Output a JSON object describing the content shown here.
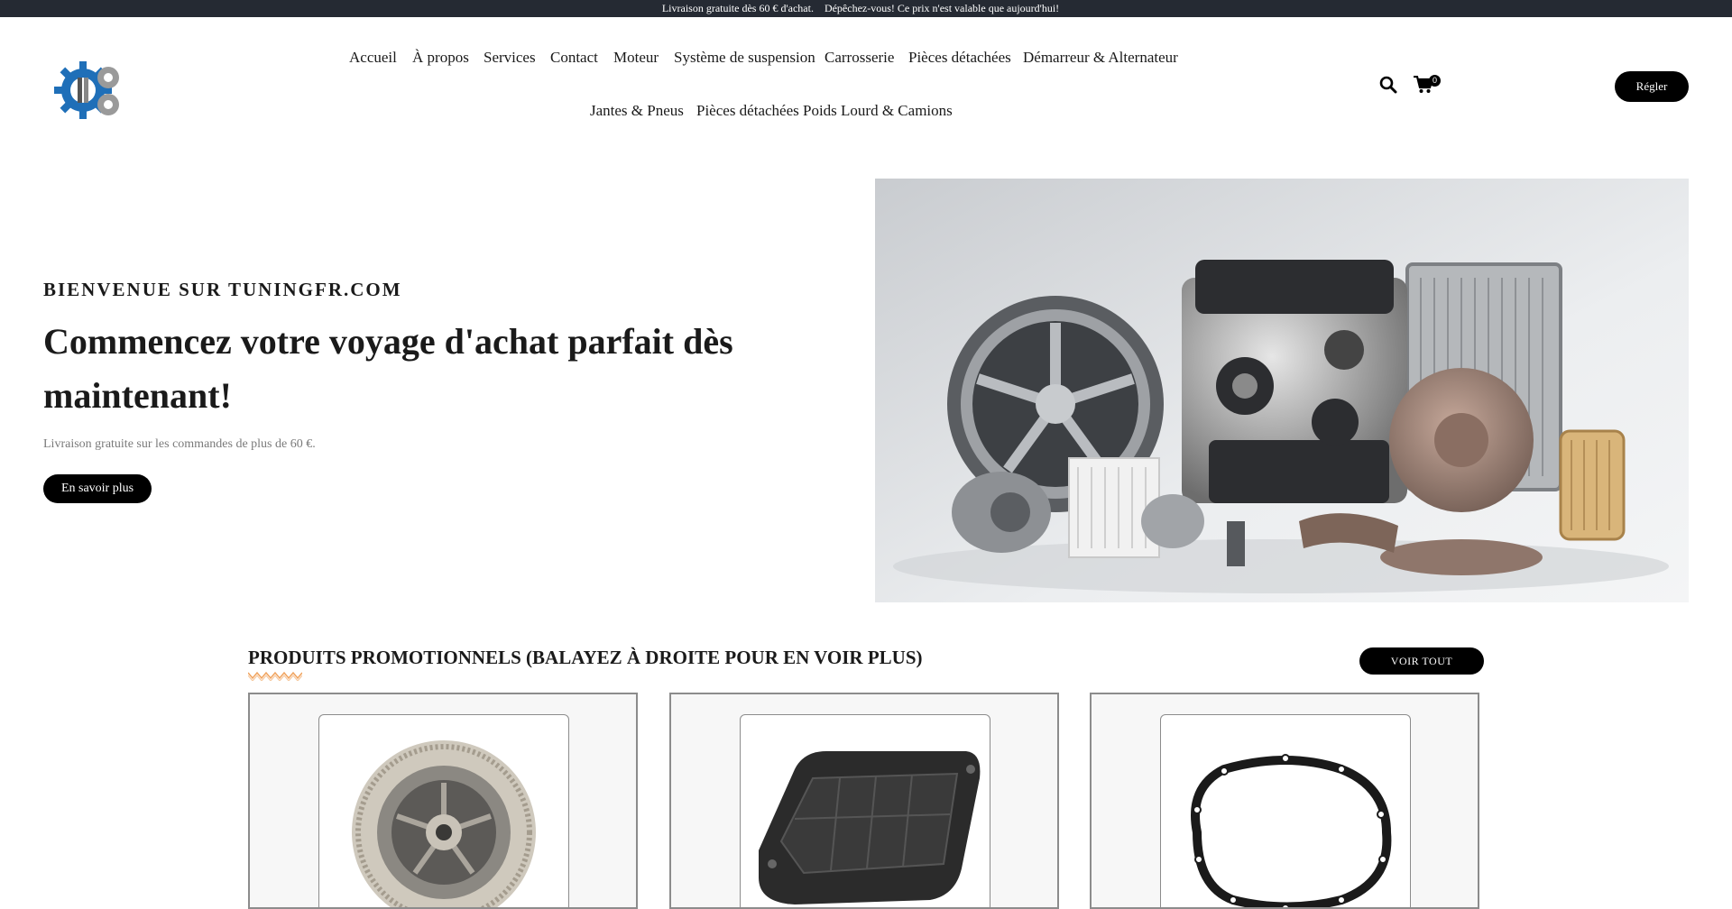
{
  "announcement": "Livraison gratuite dès 60 € d'achat. Dépêchez-vous! Ce prix n'est valable que aujourd'hui! ",
  "brand": {
    "logo_icon": "gear-wrench-logo-icon"
  },
  "nav": {
    "items": [
      "Accueil",
      "À propos",
      "Services",
      "Contact",
      "Moteur",
      "Système de suspension",
      "Carrosserie",
      "Pièces détachées",
      "Démarreur & Alternateur",
      "Jantes & Pneus",
      "Pièces détachées Poids Lourd & Camions"
    ]
  },
  "header": {
    "search_icon": "search-icon",
    "cart_icon": "cart-icon",
    "cart_count": "0",
    "checkout_label": "Régler"
  },
  "hero": {
    "eyebrow": "BIENVENUE SUR TUNINGFR.COM",
    "title": "Commencez votre voyage d'achat parfait dès maintenant!",
    "subtitle": "Livraison gratuite sur les commandes de plus de 60 €.",
    "cta_label": "En savoir plus",
    "image": "auto-parts-photo"
  },
  "promo": {
    "title": "PRODUITS PROMOTIONNELS (BALAYEZ À DROITE POUR EN VOIR PLUS)",
    "view_all_label": "VOIR TOUT",
    "accent_color": "#f0a35e",
    "products": [
      {
        "image": "clutch-flywheel-image"
      },
      {
        "image": "transmission-oil-pan-image"
      },
      {
        "image": "gasket-image"
      }
    ]
  },
  "colors": {
    "topbar_bg": "#252a33",
    "button_bg": "#000000",
    "card_border": "#8c8c8c"
  }
}
